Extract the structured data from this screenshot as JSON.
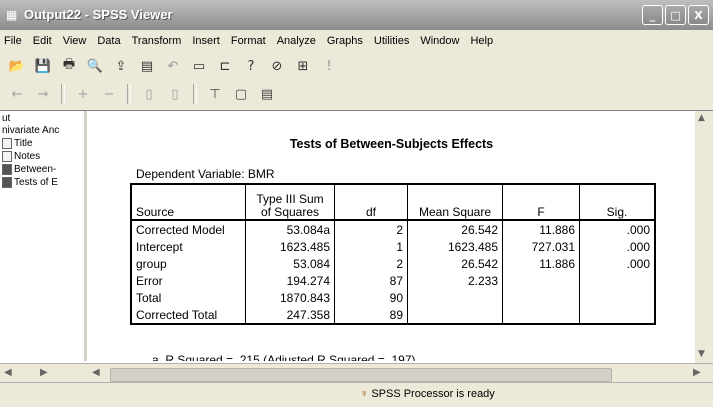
{
  "window": {
    "title": "Output22 - SPSS Viewer",
    "buttons": [
      "_",
      "□",
      "X"
    ]
  },
  "menu": [
    "File",
    "Edit",
    "View",
    "Data",
    "Transform",
    "Insert",
    "Format",
    "Analyze",
    "Graphs",
    "Utilities",
    "Window",
    "Help"
  ],
  "outline": {
    "items": [
      {
        "label": "ut",
        "icon": ""
      },
      {
        "label": "nivariate Anc",
        "icon": ""
      },
      {
        "label": "Title",
        "icon": "page-icon"
      },
      {
        "label": "Notes",
        "icon": "page-icon"
      },
      {
        "label": "Between-",
        "icon": "table-icon"
      },
      {
        "label": "Tests of E",
        "icon": "table-icon"
      }
    ]
  },
  "output": {
    "title": "Tests of Between-Subjects Effects",
    "dependent_variable": "Dependent Variable: BMR",
    "columns": [
      "Source",
      "Type III Sum\nof Squares",
      "df",
      "Mean Square",
      "F",
      "Sig."
    ],
    "rows": [
      [
        "Corrected Model",
        "53.084a",
        "2",
        "26.542",
        "11.886",
        ".000"
      ],
      [
        "Intercept",
        "1623.485",
        "1",
        "1623.485",
        "727.031",
        ".000"
      ],
      [
        "group",
        "53.084",
        "2",
        "26.542",
        "11.886",
        ".000"
      ],
      [
        "Error",
        "194.274",
        "87",
        "2.233",
        "",
        ""
      ],
      [
        "Total",
        "1870.843",
        "90",
        "",
        "",
        ""
      ],
      [
        "Corrected Total",
        "247.358",
        "89",
        "",
        "",
        ""
      ]
    ],
    "footnote": "a. R Squared = .215 (Adjusted R Squared = .197)"
  },
  "status": {
    "text": "SPSS Processor  is ready"
  }
}
